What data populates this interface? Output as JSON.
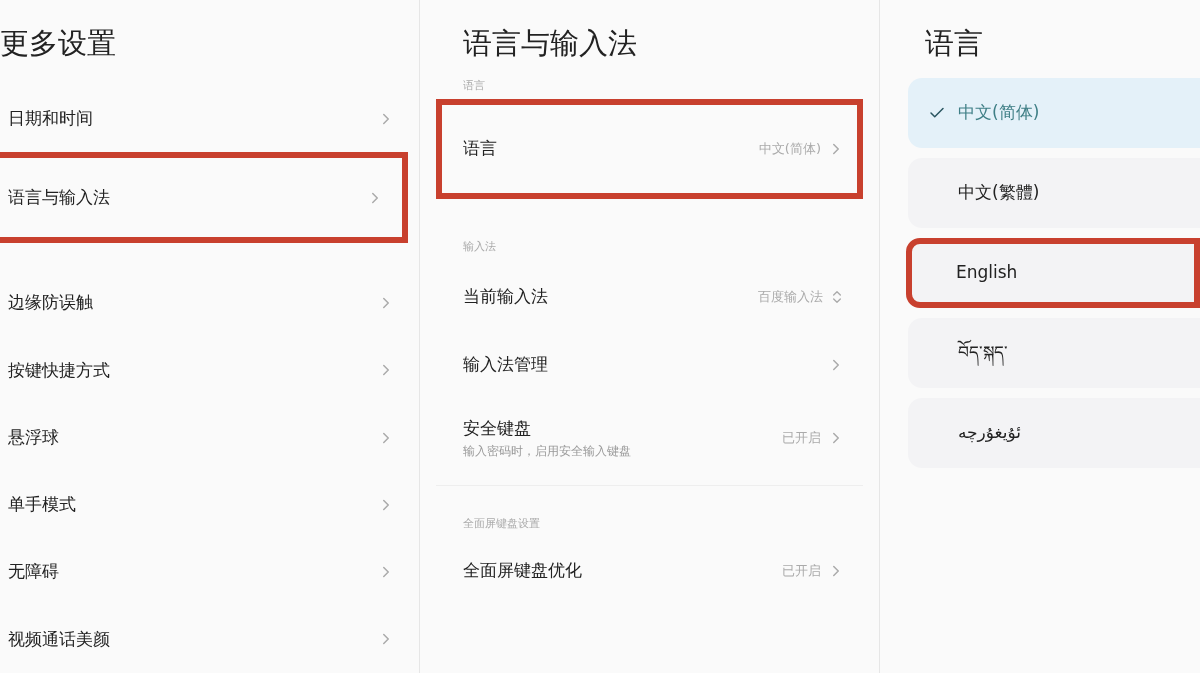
{
  "more_settings": {
    "title": "更多设置",
    "items": [
      {
        "label": "日期和时间",
        "highlighted": false
      },
      {
        "label": "语言与输入法",
        "highlighted": true
      },
      {
        "label": "边缘防误触",
        "highlighted": false
      },
      {
        "label": "按键快捷方式",
        "highlighted": false
      },
      {
        "label": "悬浮球",
        "highlighted": false
      },
      {
        "label": "单手模式",
        "highlighted": false
      },
      {
        "label": "无障碍",
        "highlighted": false
      },
      {
        "label": "视频通话美颜",
        "highlighted": false
      }
    ]
  },
  "language_input": {
    "title": "语言与输入法",
    "sections": [
      {
        "header": "语言",
        "items": [
          {
            "label": "语言",
            "value": "中文(简体)",
            "kind": "link",
            "highlighted": true
          }
        ]
      },
      {
        "header": "输入法",
        "items": [
          {
            "label": "当前输入法",
            "value": "百度输入法",
            "kind": "picker",
            "highlighted": false
          },
          {
            "label": "输入法管理",
            "kind": "link",
            "highlighted": false
          },
          {
            "label": "安全键盘",
            "subtitle": "输入密码时，启用安全输入键盘",
            "value": "已开启",
            "kind": "link",
            "highlighted": false
          }
        ]
      },
      {
        "header": "全面屏键盘设置",
        "items": [
          {
            "label": "全面屏键盘优化",
            "value": "已开启",
            "kind": "link",
            "highlighted": false
          }
        ]
      }
    ]
  },
  "language": {
    "title": "语言",
    "options": [
      {
        "label": "中文(简体)",
        "selected": true,
        "highlighted": false
      },
      {
        "label": "中文(繁體)",
        "selected": false,
        "highlighted": false
      },
      {
        "label": "English",
        "selected": false,
        "highlighted": true
      },
      {
        "label": "བོད་སྐད་",
        "selected": false,
        "highlighted": false
      },
      {
        "label": "ئۇيغۇرچە",
        "selected": false,
        "highlighted": false
      }
    ]
  }
}
